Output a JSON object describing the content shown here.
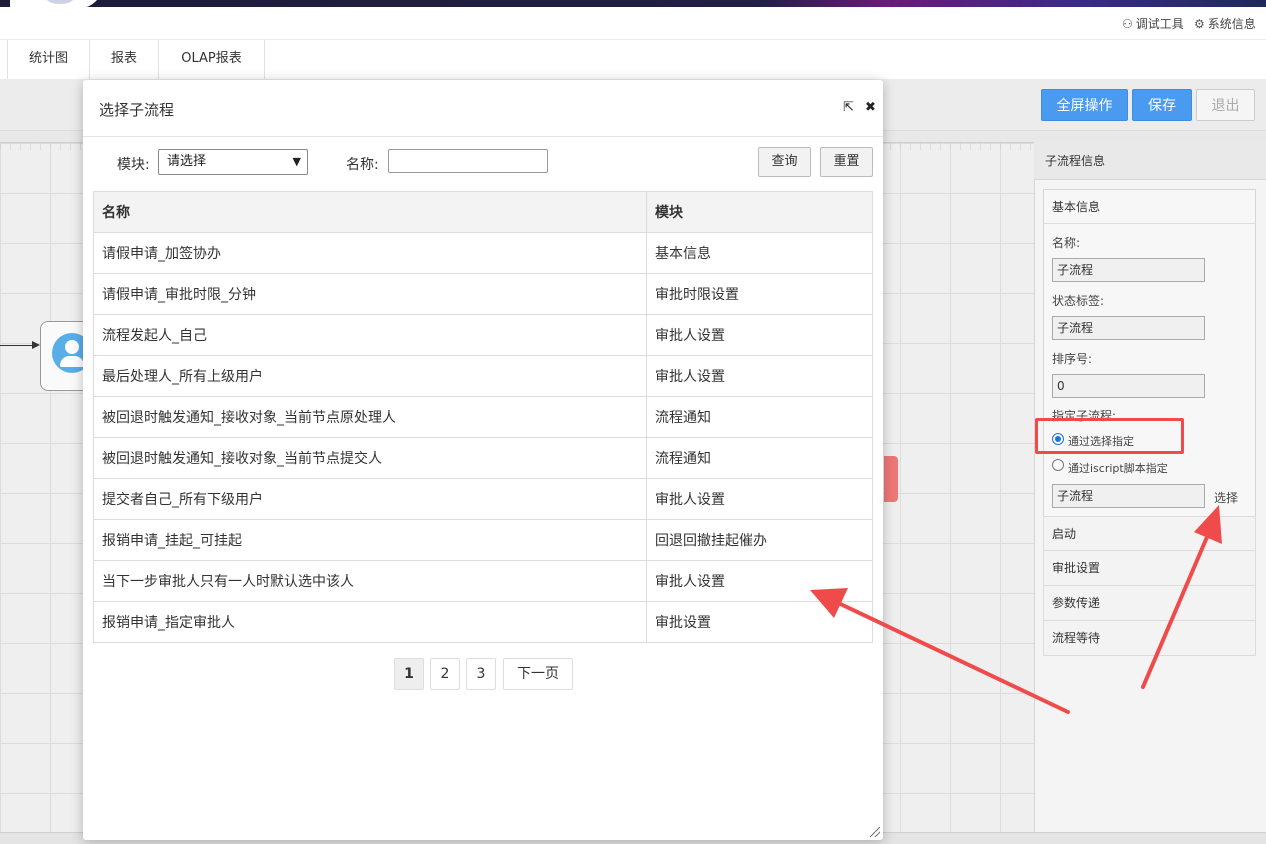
{
  "header": {
    "debug_tool_label": "调试工具",
    "system_info_label": "系统信息"
  },
  "tabs": [
    {
      "label": "统计图"
    },
    {
      "label": "报表"
    },
    {
      "label": "OLAP报表"
    }
  ],
  "toolbar": {
    "fullscreen_label": "全屏操作",
    "save_label": "保存",
    "exit_label": "退出"
  },
  "modal": {
    "title": "选择子流程",
    "query": {
      "module_label": "模块:",
      "module_selected": "请选择",
      "name_label": "名称:",
      "name_value": "",
      "search_label": "查询",
      "reset_label": "重置"
    },
    "table": {
      "columns": [
        "名称",
        "模块"
      ],
      "rows": [
        [
          "请假申请_加签协办",
          "基本信息"
        ],
        [
          "请假申请_审批时限_分钟",
          "审批时限设置"
        ],
        [
          "流程发起人_自己",
          "审批人设置"
        ],
        [
          "最后处理人_所有上级用户",
          "审批人设置"
        ],
        [
          "被回退时触发通知_接收对象_当前节点原处理人",
          "流程通知"
        ],
        [
          "被回退时触发通知_接收对象_当前节点提交人",
          "流程通知"
        ],
        [
          "提交者自己_所有下级用户",
          "审批人设置"
        ],
        [
          "报销申请_挂起_可挂起",
          "回退回撤挂起催办"
        ],
        [
          "当下一步审批人只有一人时默认选中该人",
          "审批人设置"
        ],
        [
          "报销申请_指定审批人",
          "审批设置"
        ]
      ]
    },
    "pager": {
      "pages": [
        "1",
        "2",
        "3"
      ],
      "current": "1",
      "next_label": "下一页"
    }
  },
  "right_panel": {
    "title": "子流程信息",
    "basic_info": {
      "header": "基本信息",
      "name_label": "名称:",
      "name_value": "子流程",
      "status_label": "状态标签:",
      "status_value": "子流程",
      "order_label": "排序号:",
      "order_value": "0",
      "assign_label": "指定子流程:",
      "radio_select_label": "通过选择指定",
      "radio_script_label": "通过iscript脚本指定",
      "subflow_value": "子流程",
      "choose_label": "选择"
    },
    "sections": [
      "启动",
      "审批设置",
      "参数传递",
      "流程等待"
    ]
  },
  "colors": {
    "primary": "#4a9bef",
    "annotation": "#f04b4b"
  }
}
